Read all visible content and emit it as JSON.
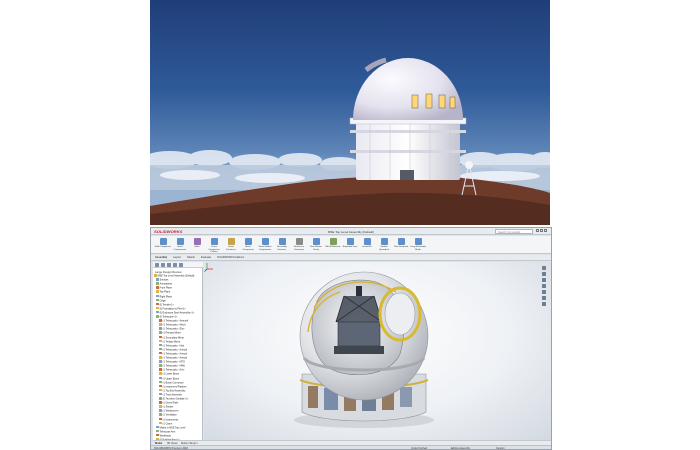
{
  "window": {
    "app_logo": "SOLIDWORKS",
    "title": "MSE Top Level Assembly (Default)",
    "search_placeholder": "Search Commands"
  },
  "ribbon": {
    "buttons": [
      "Edit Component",
      "Insert Components",
      "Mate",
      "Linear Component Pattern",
      "Smart Fasteners",
      "Move Component",
      "Show Hidden Components",
      "Assembly Features",
      "Reference Geometry",
      "New Motion Study",
      "Bill of Materials",
      "Exploded View",
      "Instant3D",
      "Update Speedpak",
      "Take Snapshot",
      "Large Assembly Mode"
    ]
  },
  "command_tabs": [
    "Assembly",
    "Layout",
    "Sketch",
    "Evaluate",
    "SOLIDWORKS Add-Ins"
  ],
  "tree": {
    "filter_label": "Large Design Review",
    "nodes": [
      "MSE Top Level Assembly (Default)",
      "Sensors",
      "Annotations",
      "Front Plane",
      "Top Plane",
      "Right Plane",
      "Origin",
      "(f) Terrain<1>",
      "(f) Foundation & Pier<1>",
      "(f) Enclosure Steel Assembly<1>",
      "(f) Telescope<1>",
      "(-) Telescopitu - Azimuth",
      "(-) Telescopitu - Mech",
      "(-) Telescopitu - Elev",
      "(-) Primary Mirror",
      "(-) Secondary Mirror",
      "(-) Tertiary Mirror",
      "(-) Telescopitu - Hub",
      "(-) Telescopitu - Annual",
      "(-) Telescopitu - Annual",
      "(-) Telescopitu - Annual",
      "(-) Telescopitu - MTO",
      "(-) Telescopitu - HMU",
      "(-) Telescopitu - Kinv",
      "(-) Lower Boom",
      "(-) Upper Boom",
      "(-) Boom Connector",
      "(-) Instrument Platform",
      "(-) Top End Assembly",
      "(-) Trust Assembly",
      "(f) Trunnion Gimbals<1>",
      "(-) Dome Rails",
      "(-) Shutter",
      "(-) Windscreen",
      "(-) Ventilation",
      "(-) Instruments",
      "(-) Crane",
      "Mates in MSE Top Level",
      "Telescope Arm",
      "Workloads",
      "(f) Building Bay<1>"
    ]
  },
  "tree_tabs": [
    "Model",
    "3D Views",
    "Motion Study 1"
  ],
  "status": {
    "app": "SOLIDWORKS Premium 2018",
    "state": "Under Defined",
    "mode": "Editing Assembly",
    "units": "Custom"
  }
}
